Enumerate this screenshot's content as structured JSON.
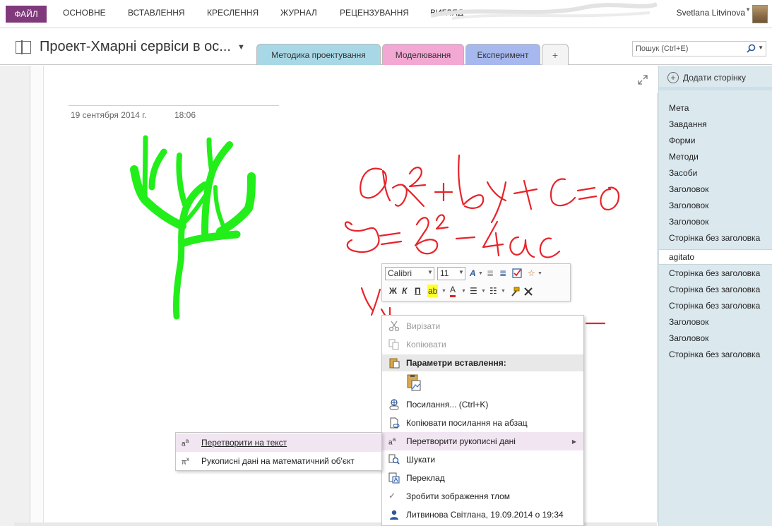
{
  "ribbon": {
    "file_tab": "ФАЙЛ",
    "tabs": [
      "ОСНОВНЕ",
      "ВСТАВЛЕННЯ",
      "КРЕСЛЕННЯ",
      "ЖУРНАЛ",
      "РЕЦЕНЗУВАННЯ",
      "ВИГЛЯД"
    ],
    "user_name": "Svetlana Litvinova"
  },
  "notebook": {
    "title": "Проект-Хмарні сервіси в ос...",
    "sections": [
      "Методика проектування",
      "Моделювання",
      "Експеримент"
    ],
    "add_section": "+",
    "search_placeholder": "Пошук (Ctrl+E)"
  },
  "page": {
    "date": "19 сентября 2014 г.",
    "time": "18:06"
  },
  "pages_pane": {
    "add_page": "Додати сторінку",
    "items": [
      "Мета",
      "Завдання",
      "Форми",
      "Методи",
      "Засоби",
      "Заголовок",
      "Заголовок",
      "Заголовок",
      "Сторінка без заголовка",
      "agitato",
      "Сторінка без заголовка",
      "Сторінка без заголовка",
      "Сторінка без заголовка",
      "Заголовок",
      "Заголовок",
      "Сторінка без заголовка"
    ],
    "selected_index": 9
  },
  "mini_toolbar": {
    "font": "Calibri",
    "size": "11",
    "bold": "Ж",
    "italic": "К",
    "underline": "П"
  },
  "context_menu": {
    "cut": "Вирізати",
    "copy": "Копіювати",
    "paste_options": "Параметри вставлення:",
    "link": "Посилання... (Ctrl+K)",
    "copy_link": "Копіювати посилання на абзац",
    "convert_ink": "Перетворити рукописні дані",
    "search": "Шукати",
    "translate": "Переклад",
    "set_background": "Зробити зображення тлом",
    "author": "Литвинова Світлана, 19.09.2014 о 19:34"
  },
  "submenu": {
    "to_text": "Перетворити на текст",
    "to_math": "Рукописні дані на математичний об'єкт"
  },
  "colors": {
    "file_tab": "#80397b",
    "tab_methodology": "#a8d8e6",
    "tab_modeling": "#f3a8d4",
    "tab_experiment": "#a6b8ee",
    "pages_pane": "#dbe9ef",
    "ink_red": "#e8232a",
    "ink_green": "#22ee1a",
    "menu_highlight": "#f1e5f2"
  },
  "icons": [
    "search-icon",
    "expand-icon",
    "add-page-icon",
    "scissors-icon",
    "copy-icon",
    "paste-icon",
    "link-icon",
    "copy-link-icon",
    "convert-ink-icon",
    "search-menu-icon",
    "translate-icon",
    "checkmark-icon",
    "user-icon",
    "ink-to-text-icon",
    "ink-to-math-icon"
  ]
}
